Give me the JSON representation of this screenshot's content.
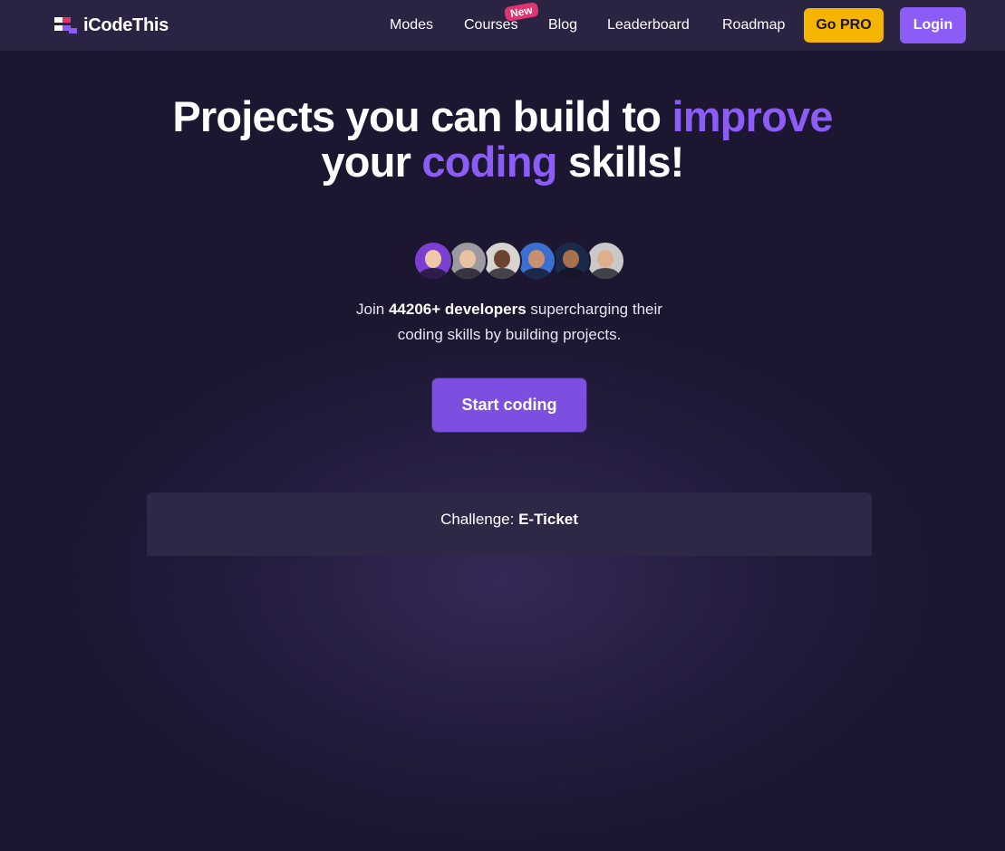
{
  "brand": {
    "name": "iCodeThis"
  },
  "nav": {
    "modes": "Modes",
    "courses": "Courses",
    "courses_badge": "New",
    "blog": "Blog",
    "leaderboard": "Leaderboard",
    "roadmap": "Roadmap",
    "go_pro": "Go PRO",
    "login": "Login"
  },
  "hero": {
    "title_part1": "Projects you can build to ",
    "title_highlight1": "improve",
    "title_part2": "your ",
    "title_highlight2": "coding",
    "title_part3": " skills!",
    "join_prefix": "Join ",
    "join_count": "44206+ developers",
    "join_suffix_line1": " supercharging their",
    "join_line2": "coding skills by building projects.",
    "cta": "Start coding"
  },
  "avatars": [
    {
      "name": "avatar-1",
      "bg": "#7b3fd1"
    },
    {
      "name": "avatar-2",
      "bg": "#9a9aa0"
    },
    {
      "name": "avatar-3",
      "bg": "#d8d4d0"
    },
    {
      "name": "avatar-4",
      "bg": "#3b6fd0"
    },
    {
      "name": "avatar-5",
      "bg": "#1b2a4a"
    },
    {
      "name": "avatar-6",
      "bg": "#c9c9cc"
    }
  ],
  "challenge": {
    "label": "Challenge: ",
    "name": "E-Ticket"
  },
  "colors": {
    "background": "#1c1630",
    "header": "#2a2342",
    "accent": "#8b5cf6",
    "pro": "#f4b400",
    "badge": "#e0336f"
  }
}
